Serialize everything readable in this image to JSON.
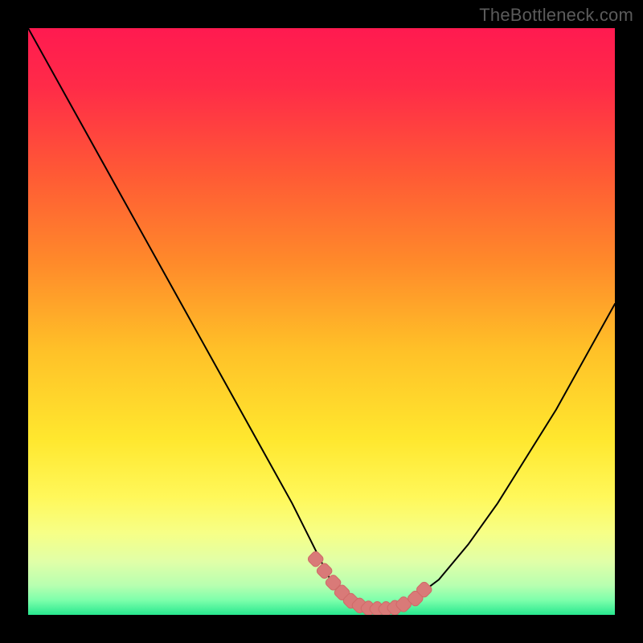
{
  "attribution": "TheBottleneck.com",
  "gradient_stops": [
    {
      "offset": 0.0,
      "color": "#ff1a50"
    },
    {
      "offset": 0.1,
      "color": "#ff2b48"
    },
    {
      "offset": 0.25,
      "color": "#ff5a35"
    },
    {
      "offset": 0.4,
      "color": "#ff8a2a"
    },
    {
      "offset": 0.55,
      "color": "#ffc128"
    },
    {
      "offset": 0.7,
      "color": "#ffe72e"
    },
    {
      "offset": 0.8,
      "color": "#fff85a"
    },
    {
      "offset": 0.86,
      "color": "#f7ff86"
    },
    {
      "offset": 0.91,
      "color": "#e0ffa8"
    },
    {
      "offset": 0.95,
      "color": "#b7ffb0"
    },
    {
      "offset": 0.975,
      "color": "#7dffab"
    },
    {
      "offset": 1.0,
      "color": "#28e88f"
    }
  ],
  "marker_color": "#d97a78",
  "marker_stroke": "#cf6a68",
  "curve_color": "#000000",
  "chart_data": {
    "type": "line",
    "title": "",
    "xlabel": "",
    "ylabel": "",
    "xlim": [
      0,
      100
    ],
    "ylim": [
      0,
      100
    ],
    "series": [
      {
        "name": "bottleneck_curve",
        "x": [
          0,
          5,
          10,
          15,
          20,
          25,
          30,
          35,
          40,
          45,
          48,
          50,
          52,
          55,
          58,
          60,
          62,
          64,
          66,
          70,
          75,
          80,
          85,
          90,
          95,
          100
        ],
        "y": [
          100,
          91,
          82,
          73,
          64,
          55,
          46,
          37,
          28,
          19,
          13,
          9,
          5,
          2,
          1,
          1,
          1,
          2,
          3,
          6,
          12,
          19,
          27,
          35,
          44,
          53
        ]
      }
    ],
    "markers": {
      "name": "highlight",
      "x": [
        49,
        50.5,
        52,
        53.5,
        55,
        56.5,
        58,
        59.5,
        61,
        62.5,
        64,
        66,
        67.5
      ],
      "y": [
        9.5,
        7.5,
        5.5,
        3.8,
        2.4,
        1.6,
        1.1,
        1.0,
        1.0,
        1.2,
        1.8,
        2.8,
        4.3
      ]
    }
  }
}
